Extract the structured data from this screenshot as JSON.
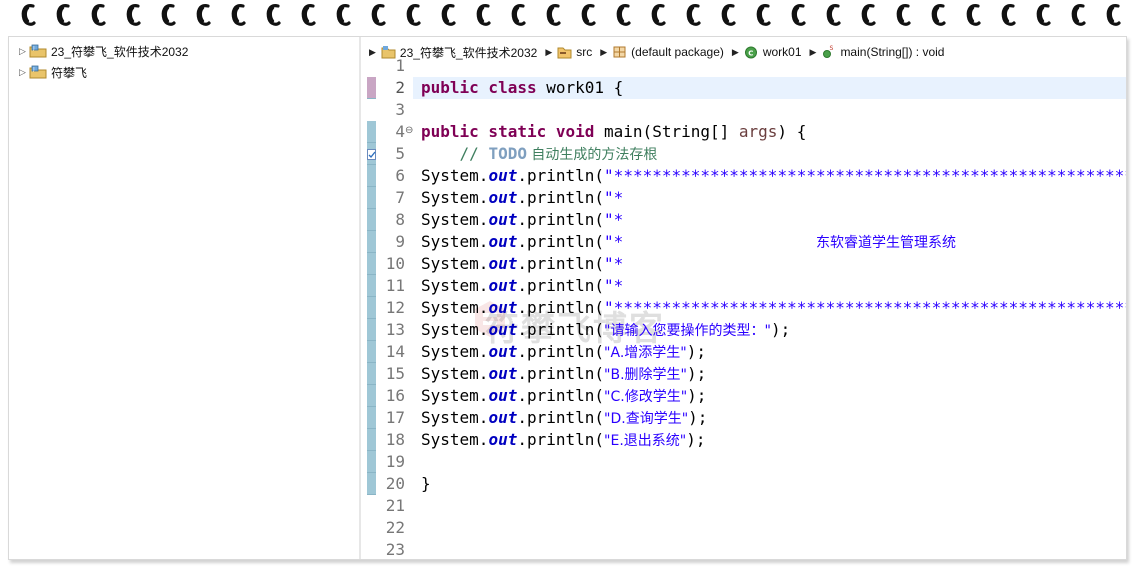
{
  "tree": {
    "items": [
      {
        "label": "23_符攀飞_软件技术2032",
        "icon": "java-project-icon"
      },
      {
        "label": "符攀飞",
        "icon": "java-project-icon"
      }
    ]
  },
  "breadcrumb": [
    {
      "label": "23_符攀飞_软件技术2032",
      "icon": "project-icon"
    },
    {
      "label": "src",
      "icon": "source-folder-icon"
    },
    {
      "label": "(default package)",
      "icon": "package-icon"
    },
    {
      "label": "work01",
      "icon": "class-icon"
    },
    {
      "label": "main(String[]) : void",
      "icon": "method-icon"
    }
  ],
  "editor": {
    "line_numbers": [
      "1",
      "2",
      "3",
      "4",
      "5",
      "6",
      "7",
      "8",
      "9",
      "10",
      "11",
      "12",
      "13",
      "14",
      "15",
      "16",
      "17",
      "18",
      "19",
      "20",
      "21",
      "22",
      "23"
    ],
    "current_line": 2,
    "lines": {
      "l2_kw": "public class",
      "l2_rest": " work01 {",
      "l4_kw": "public static void",
      "l4_rest1": " main(String[] ",
      "l4_param": "args",
      "l4_rest2": ") {",
      "l5_pre": "    // ",
      "l5_todo": "TODO",
      "l5_text": " 自动生成的方法存根",
      "sys": "System.",
      "out": "out",
      "println": ".println(",
      "l6_str": "\"*************************************************************",
      "l7_str": "\"*                                                           *",
      "l8_str": "\"*                                                           *",
      "l9_str_a": "\"*                    ",
      "l9_str_b": "东软睿道学生管理系统",
      "l9_str_c": "                         *",
      "l10_str": "\"*                                                           *",
      "l11_str": "\"*                                                           *",
      "l12_str": "\"*************************************************************",
      "l13_str": "\"请输入您要操作的类型：\"",
      "l14_str": "\"A.增添学生\"",
      "l15_str": "\"B.删除学生\"",
      "l16_str": "\"C.修改学生\"",
      "l17_str": "\"D.查询学生\"",
      "l18_str": "\"E.退出系统\"",
      "close_paren": ");",
      "l20": "}"
    }
  },
  "watermark": "符攀飞博客",
  "colors": {
    "keyword": "#7f0055",
    "string": "#2a00ff",
    "field": "#0000c0",
    "comment": "#3f7f5f",
    "current_line": "#e8f2fe",
    "ruler": "#9fc7d6"
  }
}
